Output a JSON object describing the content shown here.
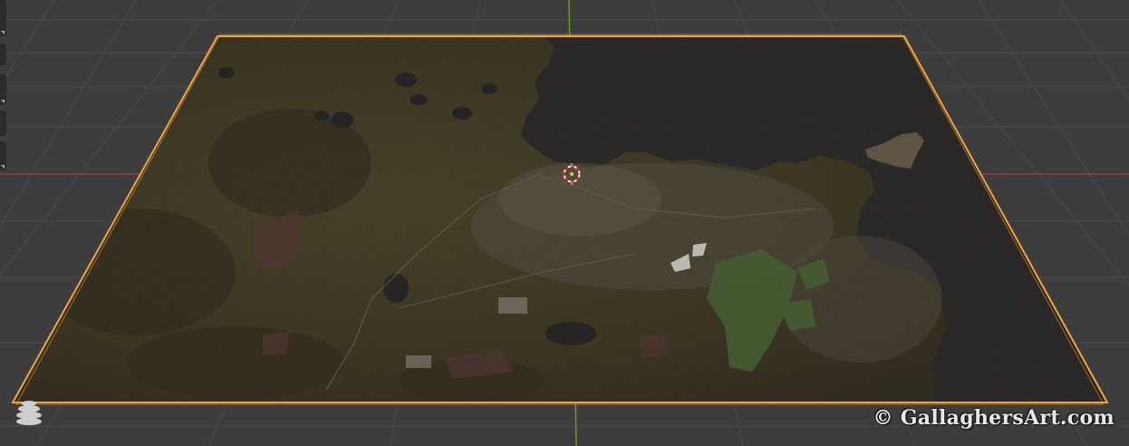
{
  "app": "Blender 3D Viewport",
  "viewport": {
    "background_color": "#3d3d3d",
    "grid_color": "#4b4b4b",
    "x_axis_color": "#9b3a3a",
    "y_axis_color": "#6e9a1a"
  },
  "scene": {
    "object": "map-plane",
    "selection_outline_color": "#f2a53a",
    "water_color": "#201e20",
    "land_color": "#3a3420",
    "cursor_icon": "3d-cursor-icon",
    "navigation_gizmo_icon": "navigation-gizmo-icon"
  },
  "watermark": {
    "text": "© GallaghersArt.com"
  }
}
